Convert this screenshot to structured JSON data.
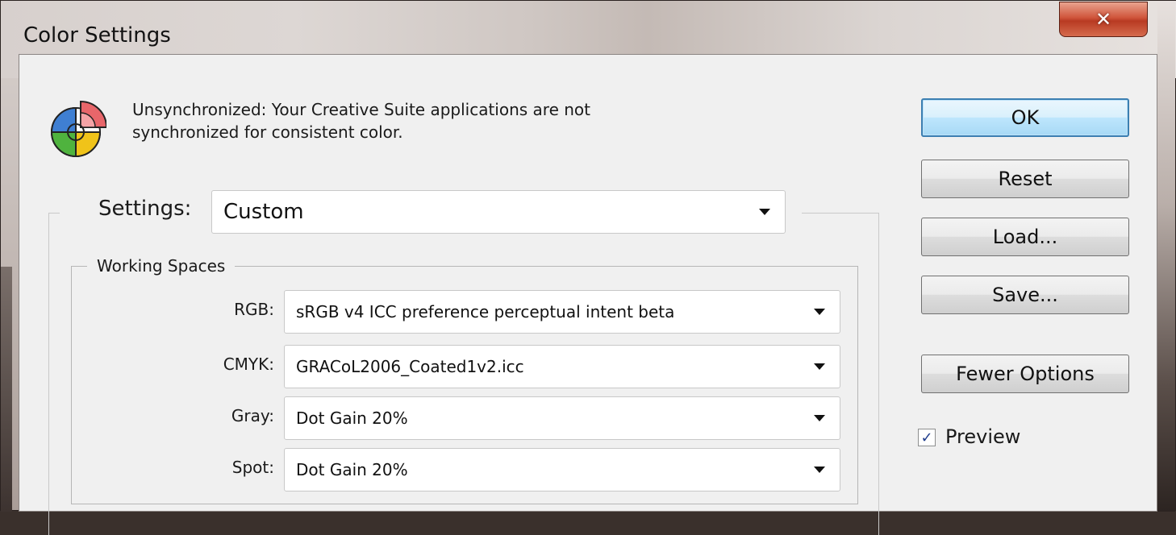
{
  "window": {
    "title": "Color Settings",
    "close_icon": "close-icon"
  },
  "sync": {
    "icon": "color-wheel-icon",
    "message_line1": "Unsynchronized: Your Creative Suite applications are not",
    "message_line2": "synchronized for consistent color."
  },
  "buttons": {
    "ok": "OK",
    "reset": "Reset",
    "load": "Load...",
    "save": "Save...",
    "fewer_options": "Fewer Options"
  },
  "preview": {
    "label": "Preview",
    "checked": true
  },
  "settings": {
    "label": "Settings:",
    "value": "Custom"
  },
  "working_spaces": {
    "title": "Working Spaces",
    "rows": [
      {
        "label": "RGB:",
        "value": "sRGB v4 ICC preference perceptual intent beta"
      },
      {
        "label": "CMYK:",
        "value": "GRACoL2006_Coated1v2.icc"
      },
      {
        "label": "Gray:",
        "value": "Dot Gain 20%"
      },
      {
        "label": "Spot:",
        "value": "Dot Gain 20%"
      }
    ]
  },
  "colors": {
    "ok_border": "#3c7fb1",
    "close_button": "#c44a30",
    "dialog_bg": "#f0f0f0"
  }
}
